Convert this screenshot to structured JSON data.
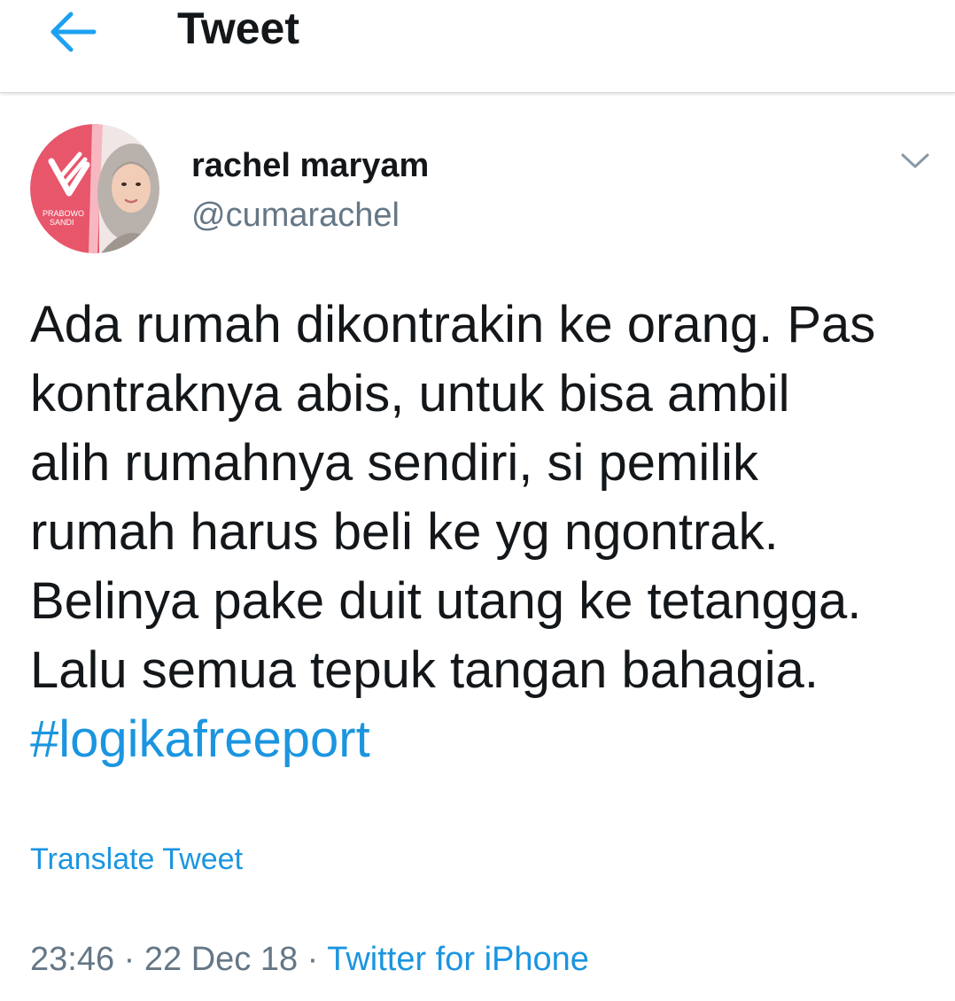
{
  "header": {
    "title": "Tweet",
    "back_icon": "arrow-left-icon",
    "accent_color": "#1da1f2"
  },
  "tweet": {
    "author": {
      "name": "rachel maryam",
      "handle": "@cumarachel",
      "avatar_badge_text": "PRABOWO SANDI"
    },
    "menu_icon": "chevron-down-icon",
    "text_lines": [
      "Ada rumah dikontrakin ke orang. Pas",
      "kontraknya abis, untuk bisa ambil",
      "alih rumahnya sendiri, si pemilik",
      "rumah harus beli ke yg ngontrak.",
      "Belinya pake duit utang ke tetangga.",
      "Lalu semua tepuk tangan bahagia."
    ],
    "hashtag": "#logikafreeport",
    "translate_label": "Translate Tweet",
    "time": "23:46",
    "date": "22 Dec 18",
    "separator": "·",
    "source": "Twitter for iPhone",
    "link_color": "#1b95e0",
    "secondary_text_color": "#657786"
  }
}
